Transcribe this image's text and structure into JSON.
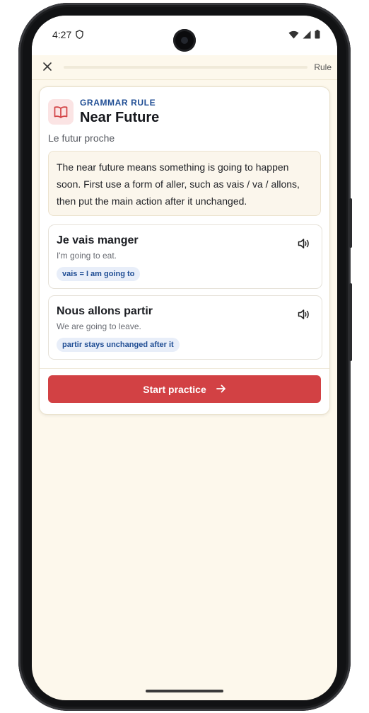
{
  "status_bar": {
    "time": "4:27"
  },
  "header": {
    "progress_label": "Rule",
    "progress": 0
  },
  "rule": {
    "eyebrow": "GRAMMAR RULE",
    "title": "Near Future",
    "subtitle": "Le futur proche",
    "explanation": "The near future means something is going to happen soon. First use a form of aller, such as vais / va / allons, then put the main action after it unchanged."
  },
  "examples": [
    {
      "french": "Je vais manger",
      "english": "I'm going to eat.",
      "note": "vais = I am going to"
    },
    {
      "french": "Nous allons partir",
      "english": "We are going to leave.",
      "note": "partir stays unchanged after it"
    }
  ],
  "cta": {
    "label": "Start practice"
  },
  "colors": {
    "accent": "#d24144",
    "brand_blue": "#1f4d94",
    "background": "#fdf8ec"
  },
  "icons": [
    "shield-icon",
    "wifi-icon",
    "signal-icon",
    "battery-icon",
    "close-icon",
    "book-icon",
    "speaker-icon",
    "arrow-right-icon"
  ]
}
